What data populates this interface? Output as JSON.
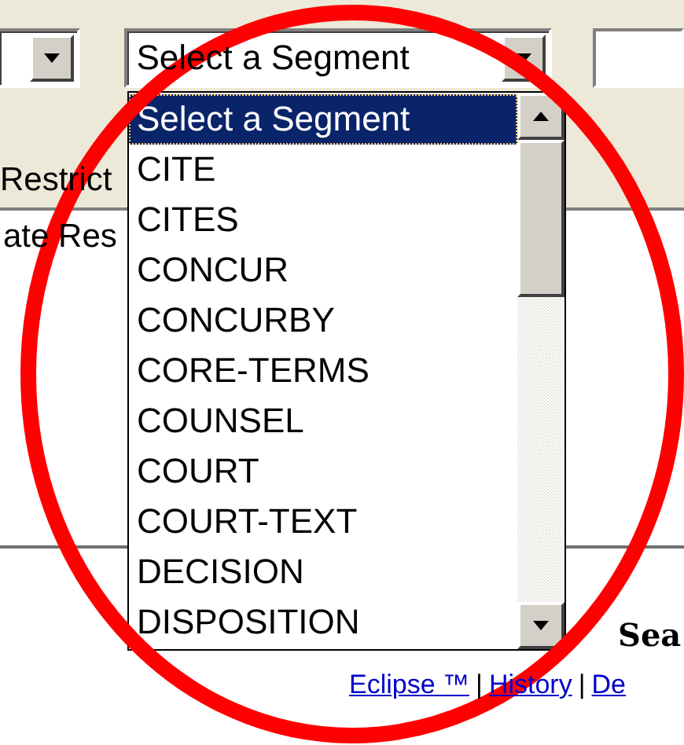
{
  "segment_select": {
    "value": "Select a Segment"
  },
  "segment_list": {
    "items": [
      {
        "label": "Select a Segment",
        "selected": true
      },
      {
        "label": "CITE",
        "selected": false
      },
      {
        "label": "CITES",
        "selected": false
      },
      {
        "label": "CONCUR",
        "selected": false
      },
      {
        "label": "CONCURBY",
        "selected": false
      },
      {
        "label": "CORE-TERMS",
        "selected": false
      },
      {
        "label": "COUNSEL",
        "selected": false
      },
      {
        "label": "COURT",
        "selected": false
      },
      {
        "label": "COURT-TEXT",
        "selected": false
      },
      {
        "label": "DECISION",
        "selected": false
      },
      {
        "label": "DISPOSITION",
        "selected": false
      }
    ]
  },
  "restrict_label": "Restrict",
  "date_restrict_label": "ate Res",
  "heading": "Sea",
  "link_bar": [
    {
      "kind": "link",
      "text": "Eclipse ™"
    },
    {
      "kind": "separator",
      "text": "|"
    },
    {
      "kind": "link",
      "text": "History"
    },
    {
      "kind": "separator",
      "text": "|"
    },
    {
      "kind": "link",
      "text": "De"
    }
  ]
}
